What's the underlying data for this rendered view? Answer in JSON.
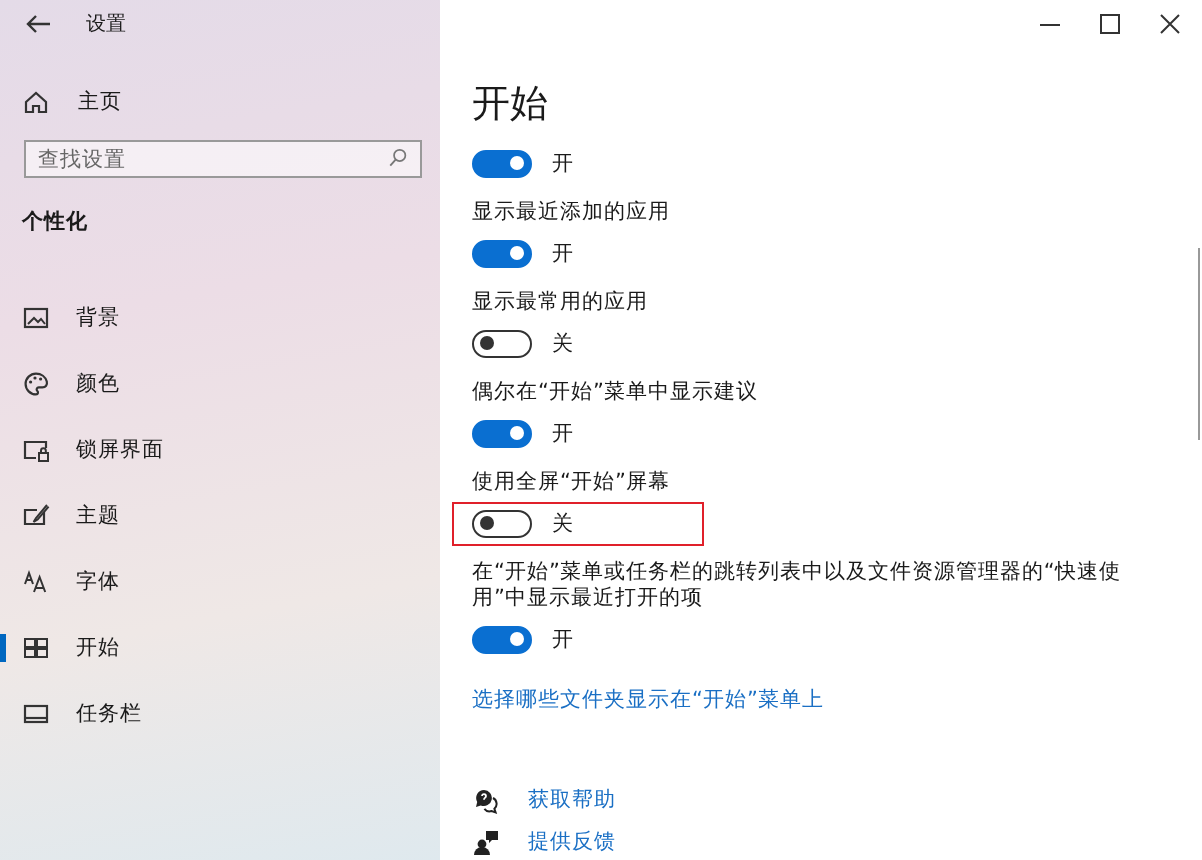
{
  "window": {
    "title": "设置"
  },
  "sidebar": {
    "home": "主页",
    "search": {
      "placeholder": "查找设置"
    },
    "section": "个性化",
    "items": [
      {
        "kind": "background",
        "label": "背景",
        "selected": false
      },
      {
        "kind": "colors",
        "label": "颜色",
        "selected": false
      },
      {
        "kind": "lockscreen",
        "label": "锁屏界面",
        "selected": false
      },
      {
        "kind": "themes",
        "label": "主题",
        "selected": false
      },
      {
        "kind": "fonts",
        "label": "字体",
        "selected": false
      },
      {
        "kind": "start",
        "label": "开始",
        "selected": true
      },
      {
        "kind": "taskbar",
        "label": "任务栏",
        "selected": false
      }
    ]
  },
  "content": {
    "title": "开始",
    "settings": [
      {
        "on": true,
        "state_text": "开",
        "highlighted": false
      },
      {
        "label": "显示最近添加的应用",
        "on": true,
        "state_text": "开",
        "highlighted": false
      },
      {
        "label": "显示最常用的应用",
        "on": false,
        "state_text": "关",
        "highlighted": false
      },
      {
        "label": "偶尔在“开始”菜单中显示建议",
        "on": true,
        "state_text": "开",
        "highlighted": false
      },
      {
        "label": "使用全屏“开始”屏幕",
        "on": false,
        "state_text": "关",
        "highlighted": true
      },
      {
        "label": "在“开始”菜单或任务栏的跳转列表中以及文件资源管理器的“快速使用”中显示最近打开的项",
        "on": true,
        "state_text": "开",
        "highlighted": false
      }
    ],
    "link": "选择哪些文件夹显示在“开始”菜单上",
    "help_links": [
      {
        "kind": "help",
        "label": "获取帮助"
      },
      {
        "kind": "feedback",
        "label": "提供反馈"
      }
    ]
  }
}
